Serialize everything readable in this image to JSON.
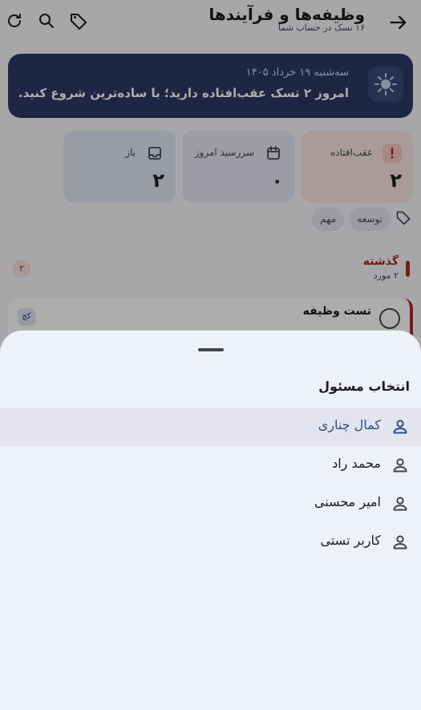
{
  "header": {
    "title": "وظیفه‌ها و فرآیندها",
    "subtitle": "۱۶ تسک در حساب شما"
  },
  "hero": {
    "date": "سه‌شنبه ۱۹ خرداد ۱۴۰۵",
    "message": "امروز ۲ تسک عقب‌افتاده دارید؛ با ساده‌ترین شروع کنید."
  },
  "stats": [
    {
      "label": "عقب‌افتاده",
      "value": "۲",
      "color": "#b3261e",
      "bg": "#f9dedc"
    },
    {
      "label": "سررسید امروز",
      "value": "۰",
      "color": "#1b1b1f",
      "bg": "#dfe3f0"
    },
    {
      "label": "باز",
      "value": "۲",
      "color": "#1b1b1f",
      "bg": "#dde6f5"
    }
  ],
  "chips": [
    "توسعه",
    "مهم"
  ],
  "section": {
    "name": "گذشته",
    "sub": "۲ مورد",
    "count": "۲"
  },
  "task": {
    "name": "تست وظیفه",
    "avatar": "کچ"
  },
  "sheet": {
    "title": "انتخاب مسئول",
    "options": [
      {
        "label": "کمال چناری",
        "selected": true
      },
      {
        "label": "محمد راد",
        "selected": false
      },
      {
        "label": "امیر محسنی",
        "selected": false
      },
      {
        "label": "کاربر تستی",
        "selected": false
      }
    ]
  },
  "colors": {
    "accent": "#2d4f8e",
    "danger": "#b3261e",
    "sheet_bg": "#eff1fa"
  }
}
